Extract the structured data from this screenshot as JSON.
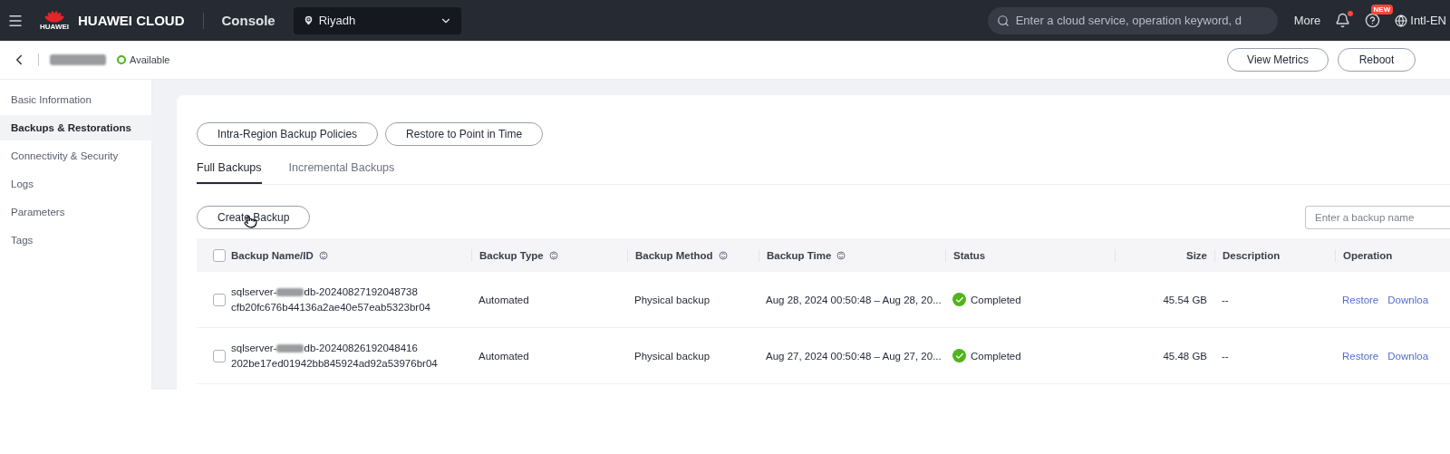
{
  "topbar": {
    "logo_caption": "HUAWEI",
    "brand": "HUAWEI CLOUD",
    "console": "Console",
    "region": "Riyadh",
    "search": {
      "placeholder": "Enter a cloud service, operation keyword, d"
    },
    "more": "More",
    "help_badge": "NEW",
    "notification_dot": true,
    "language": "Intl-EN"
  },
  "header": {
    "status": "Available",
    "buttons": [
      "View Metrics",
      "Reboot"
    ]
  },
  "sidebar": {
    "items": [
      {
        "label": "Basic Information",
        "selected": false
      },
      {
        "label": "Backups & Restorations",
        "selected": true
      },
      {
        "label": "Connectivity & Security",
        "selected": false
      },
      {
        "label": "Logs",
        "selected": false
      },
      {
        "label": "Parameters",
        "selected": false
      },
      {
        "label": "Tags",
        "selected": false
      }
    ]
  },
  "actions": [
    "Intra-Region Backup Policies",
    "Restore to Point in Time"
  ],
  "tabs": [
    {
      "label": "Full Backups",
      "selected": true
    },
    {
      "label": "Incremental Backups",
      "selected": false
    }
  ],
  "create_button": "Create Backup",
  "backup_search": {
    "placeholder": "Enter a backup name"
  },
  "table": {
    "header_checked": false,
    "columns": [
      {
        "label": "Backup Name/ID",
        "sortable": true
      },
      {
        "label": "Backup Type",
        "sortable": true
      },
      {
        "label": "Backup Method",
        "sortable": true
      },
      {
        "label": "Backup Time",
        "sortable": true
      },
      {
        "label": "Status",
        "sortable": false
      },
      {
        "label": "Size",
        "sortable": false
      },
      {
        "label": "Description",
        "sortable": false
      },
      {
        "label": "Operation",
        "sortable": false
      }
    ],
    "rows": [
      {
        "checked": false,
        "name_prefix": "sqlserver-",
        "name_suffix": "db-20240827192048738",
        "id": "cfb20fc676b44136a2ae40e57eab5323br04",
        "type": "Automated",
        "method": "Physical backup",
        "time": "Aug 28, 2024 00:50:48 – Aug 28, 20...",
        "status": "Completed",
        "size": "45.54 GB",
        "description": "--",
        "operations": [
          "Restore",
          "Downloa"
        ]
      },
      {
        "checked": false,
        "name_prefix": "sqlserver-",
        "name_suffix": "db-20240826192048416",
        "id": "202be17ed01942bb845924ad92a53976br04",
        "type": "Automated",
        "method": "Physical backup",
        "time": "Aug 27, 2024 00:50:48 – Aug 27, 20...",
        "status": "Completed",
        "size": "45.48 GB",
        "description": "--",
        "operations": [
          "Restore",
          "Downloa"
        ]
      }
    ]
  }
}
